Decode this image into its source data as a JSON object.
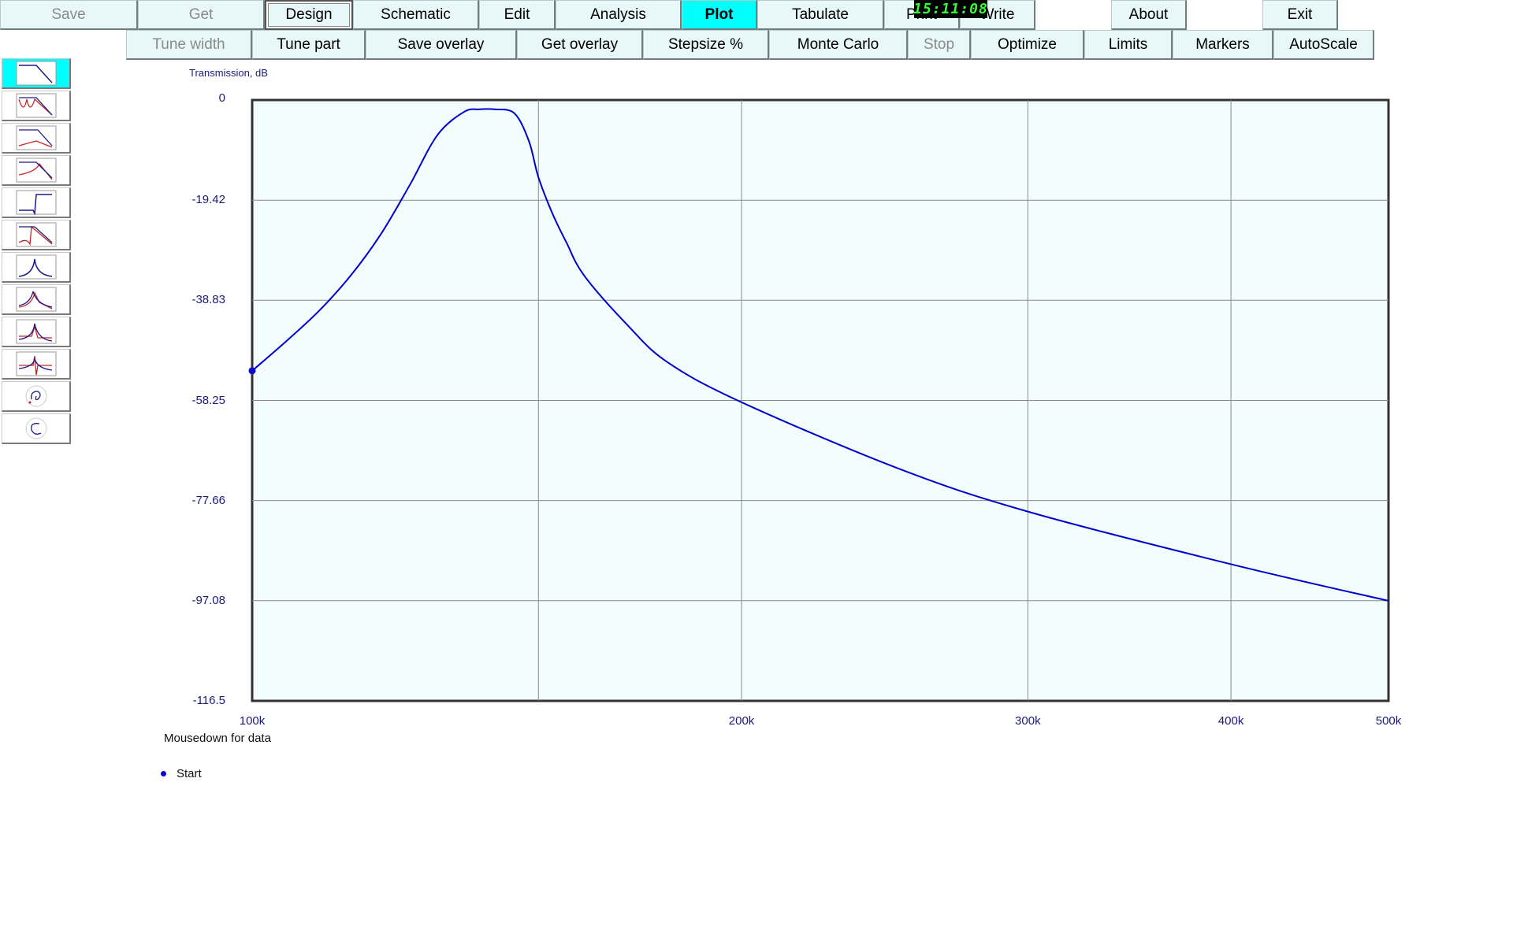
{
  "toolbar1": {
    "save": "Save",
    "get": "Get",
    "design": "Design",
    "schematic": "Schematic",
    "edit": "Edit",
    "analysis": "Analysis",
    "plot": "Plot",
    "tabulate": "Tabulate",
    "print": "Print",
    "write": "Write",
    "about": "About",
    "exit": "Exit"
  },
  "clock": "15:11:08",
  "toolbar2": {
    "tune_width": "Tune width",
    "tune_part": "Tune part",
    "save_overlay": "Save overlay",
    "get_overlay": "Get overlay",
    "stepsize": "Stepsize %",
    "monte_carlo": "Monte Carlo",
    "stop": "Stop",
    "optimize": "Optimize",
    "limits": "Limits",
    "markers": "Markers",
    "autoscale": "AutoScale"
  },
  "sidebar_icons": [
    "transmission-plot-icon",
    "return-loss-plot-icon",
    "transmission-reflection-plot-icon",
    "group-delay-plot-icon",
    "step-response-plot-icon",
    "impulse-plot-icon",
    "bandpass-response-icon",
    "bandpass-delay-icon",
    "phase-plot-icon",
    "phase-delay-plot-icon",
    "smith-chart-s11-icon",
    "smith-chart-s22-icon"
  ],
  "chart_data": {
    "type": "line",
    "ylabel": "Transmission, dB",
    "x_ticks": [
      "100k",
      "200k",
      "300k",
      "400k",
      "500k"
    ],
    "y_ticks": [
      "0",
      "-19.42",
      "-38.83",
      "-58.25",
      "-77.66",
      "-97.08",
      "-116.5"
    ],
    "xlim": [
      100000,
      500000
    ],
    "x_scale": "log",
    "ylim": [
      -116.5,
      0
    ],
    "grid": true,
    "series": [
      {
        "name": "Start",
        "color": "#0000cc",
        "x": [
          100000,
          105000,
          110000,
          115000,
          120000,
          125000,
          130000,
          135000,
          138000,
          141000,
          145000,
          148000,
          150000,
          153000,
          156000,
          160000,
          170000,
          180000,
          200000,
          250000,
          300000,
          400000,
          500000
        ],
        "y": [
          -52.5,
          -46.7,
          -40.8,
          -34.0,
          -26.0,
          -16.5,
          -6.8,
          -2.3,
          -1.8,
          -1.8,
          -2.6,
          -8.0,
          -15.0,
          -22.0,
          -27.5,
          -34.0,
          -43.5,
          -50.8,
          -58.6,
          -71.5,
          -79.8,
          -90.0,
          -97.1
        ]
      }
    ]
  },
  "mousedown_hint": "Mousedown for data",
  "legend_start": "Start"
}
